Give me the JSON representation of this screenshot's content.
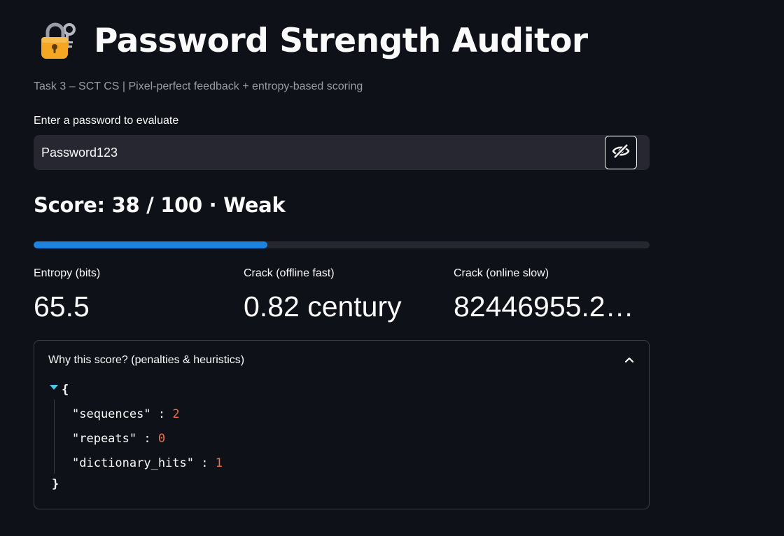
{
  "header": {
    "title": "Password Strength Auditor",
    "icon": "lock-with-key-icon",
    "subtitle": "Task 3 – SCT CS | Pixel-perfect feedback + entropy-based scoring"
  },
  "password_input": {
    "label": "Enter a password to evaluate",
    "value": "Password123",
    "toggle_icon": "eye-slash-icon"
  },
  "score": {
    "text": "Score: 38 / 100 · Weak",
    "value": 38,
    "max": 100,
    "rating": "Weak",
    "progress_fraction": 0.38
  },
  "metrics": [
    {
      "label": "Entropy (bits)",
      "value": "65.5"
    },
    {
      "label": "Crack (offline fast)",
      "value": "0.82 century"
    },
    {
      "label": "Crack (online slow)",
      "value": "82446955.22…"
    }
  ],
  "expander": {
    "label": "Why this score? (penalties & heuristics)",
    "expanded": true,
    "json": {
      "open_brace": "{",
      "close_brace": "}",
      "entries": [
        {
          "key": "\"sequences\"",
          "value": "2"
        },
        {
          "key": "\"repeats\"",
          "value": "0"
        },
        {
          "key": "\"dictionary_hits\"",
          "value": "1"
        }
      ]
    }
  },
  "colors": {
    "background": "#0e1117",
    "input_bg": "#262730",
    "accent_blue": "#1c83e1",
    "json_number": "#e8704d",
    "json_caret": "#4ec6e6",
    "muted_text": "#9a9ca3"
  }
}
